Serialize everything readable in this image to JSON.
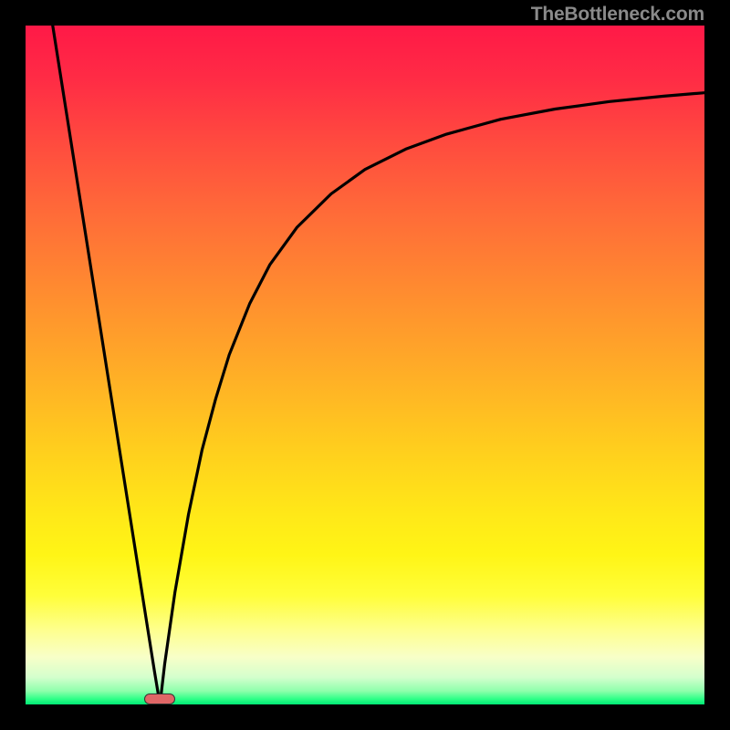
{
  "watermark": "TheBottleneck.com",
  "chart_data": {
    "type": "line",
    "title": "",
    "xlabel": "",
    "ylabel": "",
    "xlim": [
      0,
      100
    ],
    "ylim": [
      0,
      100
    ],
    "grid": false,
    "series": [
      {
        "name": "left-branch",
        "x": [
          4.0,
          6.0,
          8.0,
          10.0,
          12.0,
          14.0,
          16.0,
          18.0,
          19.0,
          19.8
        ],
        "y": [
          100.0,
          87.3,
          74.6,
          61.9,
          49.2,
          36.5,
          23.8,
          11.1,
          4.8,
          0.0
        ]
      },
      {
        "name": "right-branch",
        "x": [
          19.8,
          20.5,
          22.0,
          24.0,
          26.0,
          28.0,
          30.0,
          33.0,
          36.0,
          40.0,
          45.0,
          50.0,
          56.0,
          62.0,
          70.0,
          78.0,
          86.0,
          94.0,
          100.0
        ],
        "y": [
          0.0,
          6.0,
          16.5,
          28.0,
          37.5,
          45.0,
          51.5,
          59.0,
          64.8,
          70.3,
          75.2,
          78.8,
          81.8,
          84.0,
          86.2,
          87.7,
          88.8,
          89.6,
          90.1
        ]
      }
    ],
    "marker": {
      "x": 19.8,
      "y": 0.8,
      "shape": "pill",
      "color": "#e06666"
    },
    "background_gradient": {
      "orientation": "vertical",
      "stops": [
        {
          "pos": 0.0,
          "color": "#ff1947"
        },
        {
          "pos": 0.4,
          "color": "#ff8e2f"
        },
        {
          "pos": 0.72,
          "color": "#ffe818"
        },
        {
          "pos": 0.93,
          "color": "#f8ffc8"
        },
        {
          "pos": 1.0,
          "color": "#00e874"
        }
      ]
    }
  }
}
